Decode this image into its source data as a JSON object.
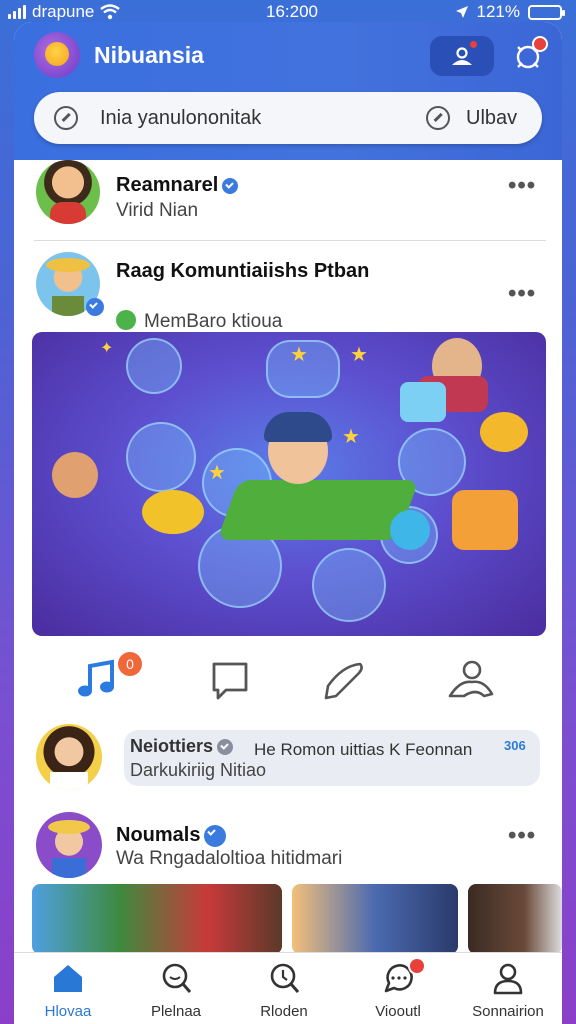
{
  "status_bar": {
    "carrier": "drapune",
    "time": "16:200",
    "battery": "121%"
  },
  "header": {
    "app_title": "Nibuansia",
    "search_placeholder": "Inia yanulononitak",
    "search_location": "Ulbav"
  },
  "feed": [
    {
      "name": "Reamnarel",
      "subtitle": "Virid Nian",
      "more": "•••"
    },
    {
      "name": "Raag Komuntiaiishs Ptban",
      "subtitle": "MemBaro ktioua",
      "more": "•••"
    }
  ],
  "message": {
    "name": "Neiottiers",
    "preview": "He Romon uittias K Feonnan",
    "sub": "Darkukiriig Nitiao",
    "count": "306"
  },
  "feed_bottom": {
    "name": "Noumals",
    "subtitle": "Wa Rngadaloltioa hitidmari",
    "more": "•••"
  },
  "actions": {
    "badge": "0"
  },
  "nav": [
    {
      "label": "Hlovaa",
      "icon": "home-icon",
      "active": true
    },
    {
      "label": "Plelnaa",
      "icon": "search-icon"
    },
    {
      "label": "Rloden",
      "icon": "explore-icon"
    },
    {
      "label": "Viooutl",
      "icon": "chat-icon"
    },
    {
      "label": "Sonnairion",
      "icon": "profile-icon"
    }
  ],
  "colors": {
    "accent": "#3a6fe0",
    "badge": "#e8403a",
    "active_nav": "#2a78d6"
  }
}
